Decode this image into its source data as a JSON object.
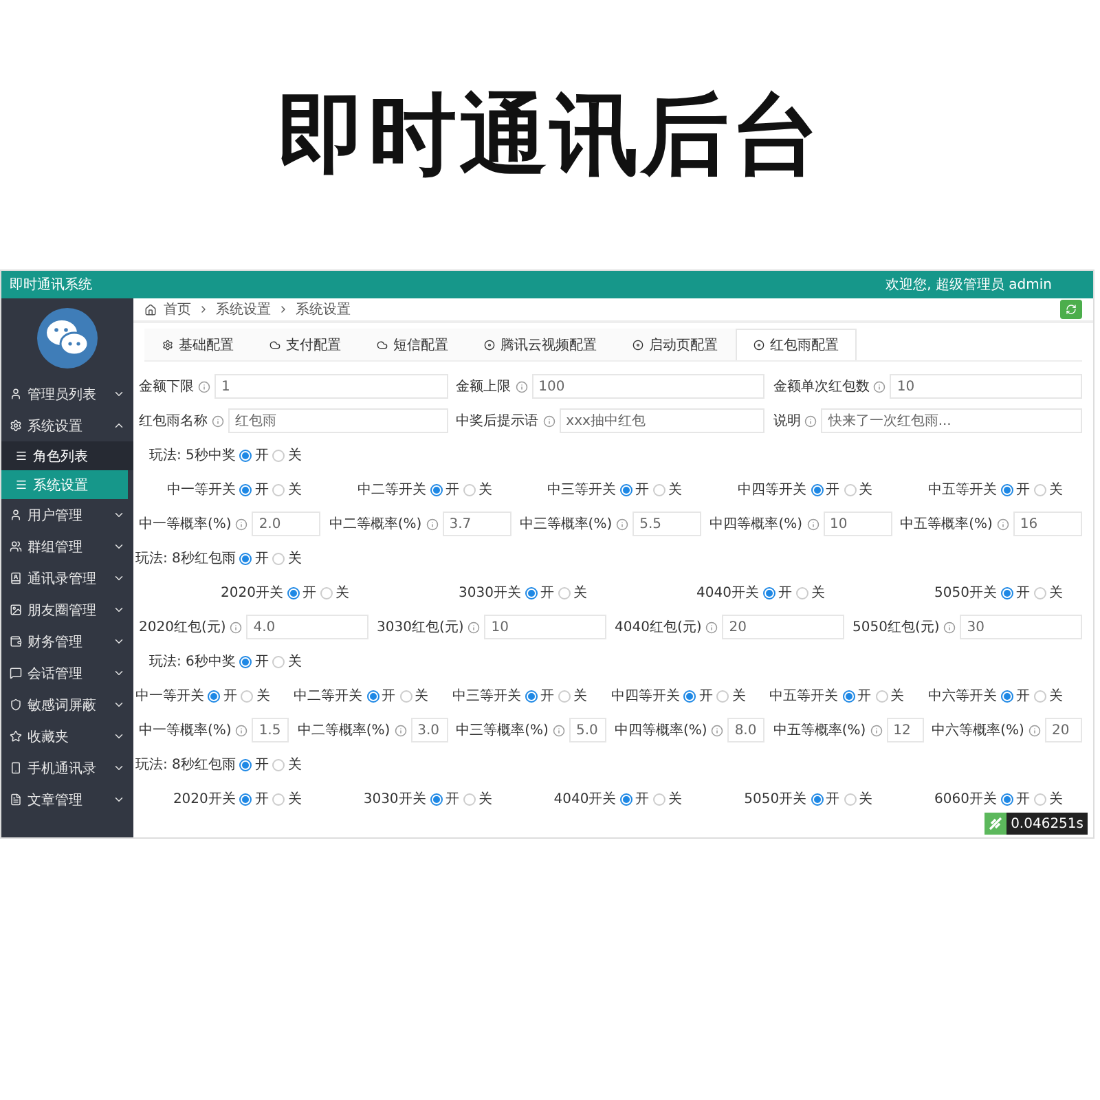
{
  "headline": "即时通讯后台",
  "app": {
    "title": "即时通讯系统",
    "welcome": "欢迎您, 超级管理员 admin"
  },
  "sidebar": {
    "items": [
      {
        "label": "管理员列表",
        "expanded": false
      },
      {
        "label": "系统设置",
        "expanded": true,
        "children": [
          {
            "label": "角色列表",
            "selected": false
          },
          {
            "label": "系统设置",
            "selected": true
          }
        ]
      },
      {
        "label": "用户管理",
        "expanded": false
      },
      {
        "label": "群组管理",
        "expanded": false
      },
      {
        "label": "通讯录管理",
        "expanded": false
      },
      {
        "label": "朋友圈管理",
        "expanded": false
      },
      {
        "label": "财务管理",
        "expanded": false
      },
      {
        "label": "会话管理",
        "expanded": false
      },
      {
        "label": "敏感词屏蔽",
        "expanded": false
      },
      {
        "label": "收藏夹",
        "expanded": false
      },
      {
        "label": "手机通讯录",
        "expanded": false
      },
      {
        "label": "文章管理",
        "expanded": false
      }
    ]
  },
  "breadcrumb": [
    "首页",
    "系统设置",
    "系统设置"
  ],
  "tabs": [
    {
      "label": "基础配置",
      "selected": false
    },
    {
      "label": "支付配置",
      "selected": false
    },
    {
      "label": "短信配置",
      "selected": false
    },
    {
      "label": "腾讯云视频配置",
      "selected": false
    },
    {
      "label": "启动页配置",
      "selected": false
    },
    {
      "label": "红包雨配置",
      "selected": true
    }
  ],
  "form": [
    {
      "kind": "fields",
      "items": [
        {
          "label": "金额下限",
          "value": "1"
        },
        {
          "label": "金额上限",
          "value": "100"
        },
        {
          "label": "金额单次红包数",
          "value": "10"
        }
      ]
    },
    {
      "kind": "fields",
      "items": [
        {
          "label": "红包雨名称",
          "value": "红包雨"
        },
        {
          "label": "中奖后提示语",
          "value": "xxx抽中红包"
        },
        {
          "label": "说明",
          "value": "快来了一次红包雨..."
        }
      ]
    },
    {
      "kind": "radios",
      "items": [
        {
          "label": "玩法: 5秒中奖",
          "options": [
            {
              "label": "开",
              "selected": true
            },
            {
              "label": "关",
              "selected": false
            }
          ]
        }
      ]
    },
    {
      "kind": "radios",
      "items": [
        {
          "label": "中一等开关",
          "options": [
            {
              "label": "开",
              "selected": true
            },
            {
              "label": "关",
              "selected": false
            }
          ]
        },
        {
          "label": "中二等开关",
          "options": [
            {
              "label": "开",
              "selected": true
            },
            {
              "label": "关",
              "selected": false
            }
          ]
        },
        {
          "label": "中三等开关",
          "options": [
            {
              "label": "开",
              "selected": true
            },
            {
              "label": "关",
              "selected": false
            }
          ]
        },
        {
          "label": "中四等开关",
          "options": [
            {
              "label": "开",
              "selected": true
            },
            {
              "label": "关",
              "selected": false
            }
          ]
        },
        {
          "label": "中五等开关",
          "options": [
            {
              "label": "开",
              "selected": true
            },
            {
              "label": "关",
              "selected": false
            }
          ]
        }
      ]
    },
    {
      "kind": "fields",
      "items": [
        {
          "label": "中一等概率(%)",
          "value": "2.0"
        },
        {
          "label": "中二等概率(%)",
          "value": "3.7"
        },
        {
          "label": "中三等概率(%)",
          "value": "5.5"
        },
        {
          "label": "中四等概率(%)",
          "value": "10"
        },
        {
          "label": "中五等概率(%)",
          "value": "16"
        }
      ]
    },
    {
      "kind": "radios",
      "items": [
        {
          "label": "玩法: 8秒红包雨",
          "options": [
            {
              "label": "开",
              "selected": true
            },
            {
              "label": "关",
              "selected": false
            }
          ]
        }
      ]
    },
    {
      "kind": "radios",
      "items": [
        {
          "label": "2020开关",
          "options": [
            {
              "label": "开",
              "selected": true
            },
            {
              "label": "关",
              "selected": false
            }
          ]
        },
        {
          "label": "3030开关",
          "options": [
            {
              "label": "开",
              "selected": true
            },
            {
              "label": "关",
              "selected": false
            }
          ]
        },
        {
          "label": "4040开关",
          "options": [
            {
              "label": "开",
              "selected": true
            },
            {
              "label": "关",
              "selected": false
            }
          ]
        },
        {
          "label": "5050开关",
          "options": [
            {
              "label": "开",
              "selected": true
            },
            {
              "label": "关",
              "selected": false
            }
          ]
        }
      ]
    },
    {
      "kind": "fields",
      "items": [
        {
          "label": "2020红包(元)",
          "value": "4.0"
        },
        {
          "label": "3030红包(元)",
          "value": "10"
        },
        {
          "label": "4040红包(元)",
          "value": "20"
        },
        {
          "label": "5050红包(元)",
          "value": "30"
        }
      ]
    },
    {
      "kind": "radios",
      "items": [
        {
          "label": "玩法: 6秒中奖",
          "options": [
            {
              "label": "开",
              "selected": true
            },
            {
              "label": "关",
              "selected": false
            }
          ]
        }
      ]
    },
    {
      "kind": "radios",
      "items": [
        {
          "label": "中一等开关",
          "options": [
            {
              "label": "开",
              "selected": true
            },
            {
              "label": "关",
              "selected": false
            }
          ]
        },
        {
          "label": "中二等开关",
          "options": [
            {
              "label": "开",
              "selected": true
            },
            {
              "label": "关",
              "selected": false
            }
          ]
        },
        {
          "label": "中三等开关",
          "options": [
            {
              "label": "开",
              "selected": true
            },
            {
              "label": "关",
              "selected": false
            }
          ]
        },
        {
          "label": "中四等开关",
          "options": [
            {
              "label": "开",
              "selected": true
            },
            {
              "label": "关",
              "selected": false
            }
          ]
        },
        {
          "label": "中五等开关",
          "options": [
            {
              "label": "开",
              "selected": true
            },
            {
              "label": "关",
              "selected": false
            }
          ]
        },
        {
          "label": "中六等开关",
          "options": [
            {
              "label": "开",
              "selected": true
            },
            {
              "label": "关",
              "selected": false
            }
          ]
        }
      ]
    },
    {
      "kind": "fields",
      "items": [
        {
          "label": "中一等概率(%)",
          "value": "1.5"
        },
        {
          "label": "中二等概率(%)",
          "value": "3.0"
        },
        {
          "label": "中三等概率(%)",
          "value": "5.0"
        },
        {
          "label": "中四等概率(%)",
          "value": "8.0"
        },
        {
          "label": "中五等概率(%)",
          "value": "12"
        },
        {
          "label": "中六等概率(%)",
          "value": "20"
        }
      ]
    },
    {
      "kind": "radios",
      "items": [
        {
          "label": "玩法: 8秒红包雨",
          "options": [
            {
              "label": "开",
              "selected": true
            },
            {
              "label": "关",
              "selected": false
            }
          ]
        }
      ]
    },
    {
      "kind": "radios",
      "items": [
        {
          "label": "2020开关",
          "options": [
            {
              "label": "开",
              "selected": true
            },
            {
              "label": "关",
              "selected": false
            }
          ]
        },
        {
          "label": "3030开关",
          "options": [
            {
              "label": "开",
              "selected": true
            },
            {
              "label": "关",
              "selected": false
            }
          ]
        },
        {
          "label": "4040开关",
          "options": [
            {
              "label": "开",
              "selected": true
            },
            {
              "label": "关",
              "selected": false
            }
          ]
        },
        {
          "label": "5050开关",
          "options": [
            {
              "label": "开",
              "selected": true
            },
            {
              "label": "关",
              "selected": false
            }
          ]
        },
        {
          "label": "6060开关",
          "options": [
            {
              "label": "开",
              "selected": true
            },
            {
              "label": "关",
              "selected": false
            }
          ]
        }
      ]
    }
  ],
  "timer": "0.046251s"
}
